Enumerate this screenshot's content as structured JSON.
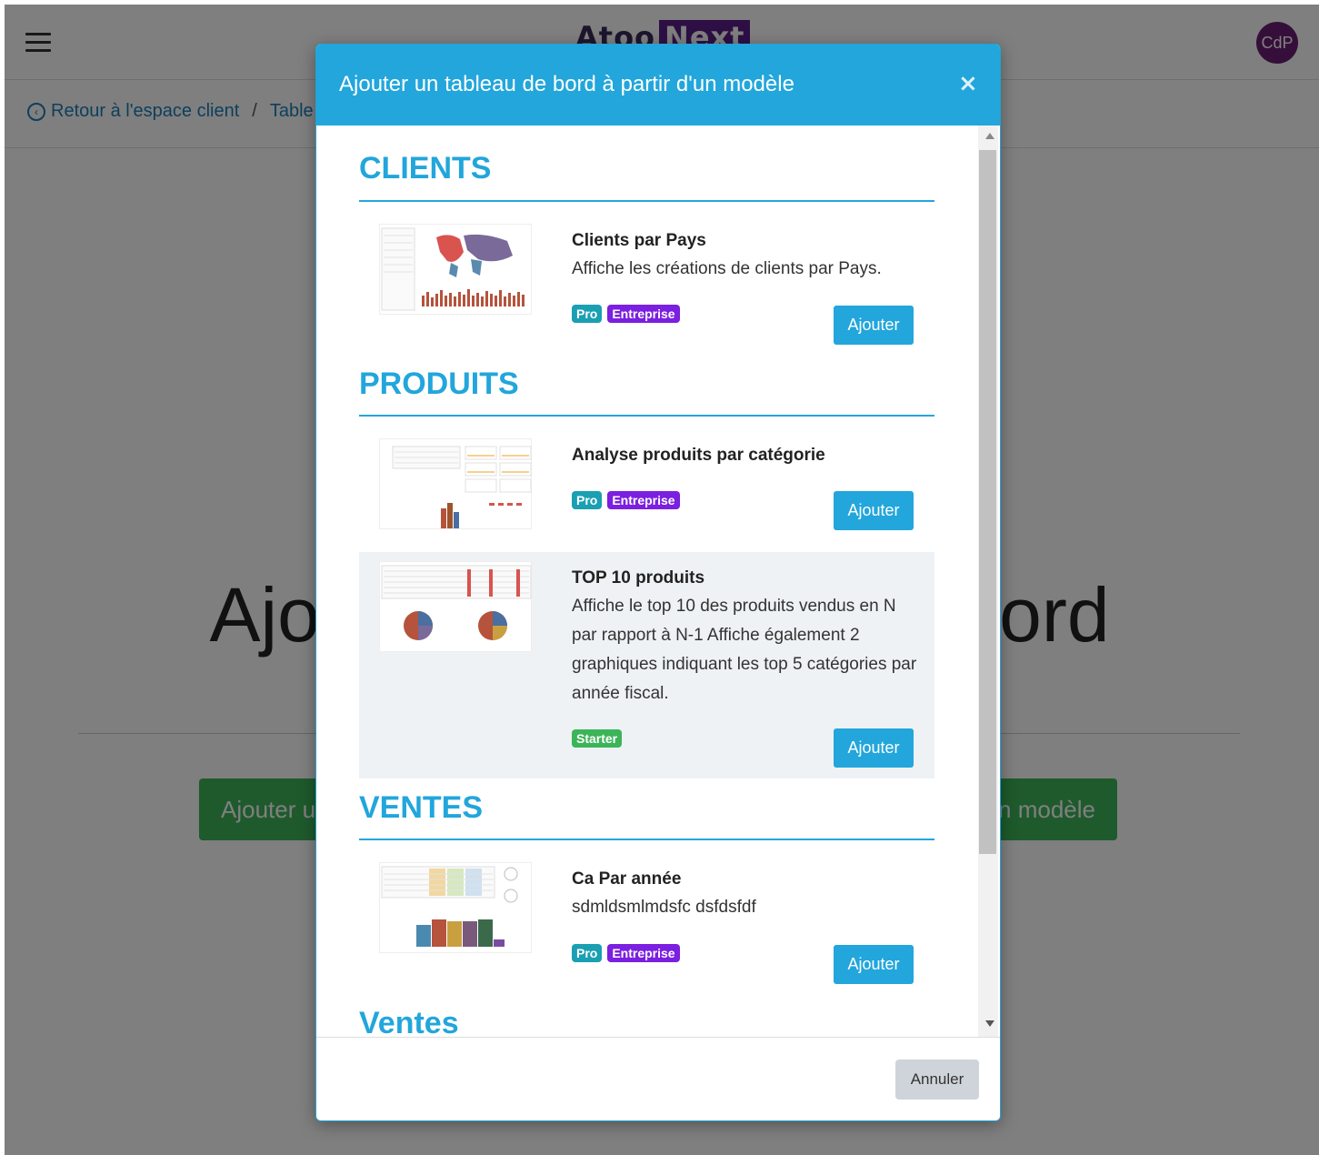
{
  "app": {
    "brand_left": "Atoo",
    "brand_right": "Next",
    "avatar_initials": "CdP",
    "breadcrumb": {
      "back_label": "Retour à l'espace client",
      "current": "Table"
    },
    "page_heading": "Ajouter un tableau de bord",
    "buttons": {
      "left": "Ajouter un tableau de bord",
      "right": "Ajouter à partir d'un modèle"
    }
  },
  "modal": {
    "title": "Ajouter un tableau de bord à partir d'un modèle",
    "close_symbol": "×",
    "add_label": "Ajouter",
    "cancel_label": "Annuler",
    "sections": [
      {
        "title": "CLIENTS",
        "templates": [
          {
            "title": "Clients par Pays",
            "description": "Affiche les créations de clients par Pays.",
            "badges": [
              "Pro",
              "Entreprise"
            ]
          }
        ]
      },
      {
        "title": "PRODUITS",
        "templates": [
          {
            "title": "Analyse produits par catégorie",
            "description": "",
            "badges": [
              "Pro",
              "Entreprise"
            ]
          },
          {
            "title": "TOP 10 produits",
            "description": "Affiche le top 10 des produits vendus en N par rapport à N-1 Affiche également 2 graphiques indiquant les top 5 catégories par année fiscal.",
            "badges": [
              "Starter"
            ]
          }
        ]
      },
      {
        "title": "VENTES",
        "templates": [
          {
            "title": "Ca Par année",
            "description": "sdmldsmlmdsfc dsfdsfdf",
            "badges": [
              "Pro",
              "Entreprise"
            ]
          }
        ]
      },
      {
        "title": "Ventes",
        "templates": []
      }
    ]
  },
  "colors": {
    "accent": "#22a6db",
    "pro": "#1a9fb3",
    "entreprise": "#7b1fe0",
    "starter": "#3cb458",
    "green_button": "#3cb458"
  }
}
